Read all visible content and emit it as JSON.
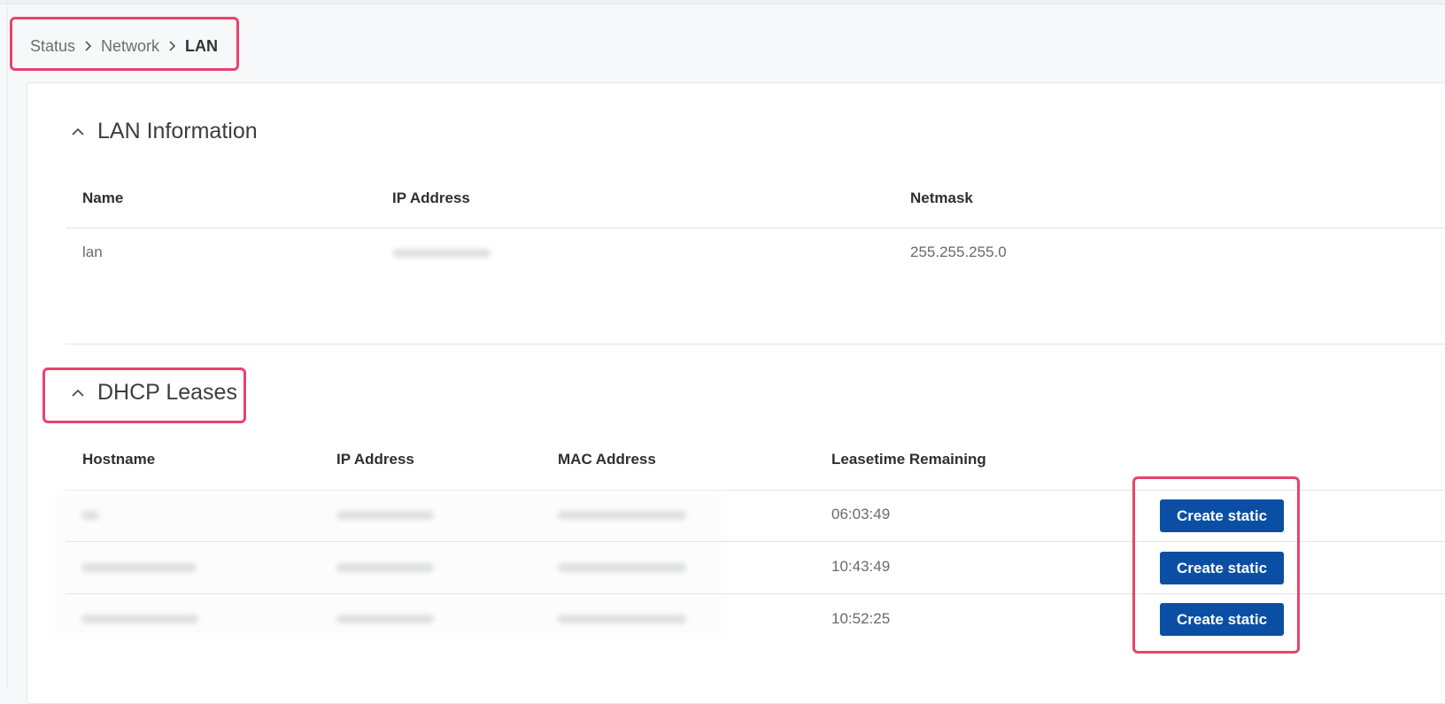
{
  "breadcrumb": {
    "items": [
      "Status",
      "Network",
      "LAN"
    ]
  },
  "lan_info": {
    "title": "LAN Information",
    "headers": [
      "Name",
      "IP Address",
      "Netmask"
    ],
    "row": {
      "name": "lan",
      "netmask": "255.255.255.0"
    }
  },
  "dhcp": {
    "title": "DHCP Leases",
    "headers": [
      "Hostname",
      "IP Address",
      "MAC Address",
      "Leasetime Remaining"
    ],
    "rows": [
      {
        "leasetime": "06:03:49",
        "action": "Create static"
      },
      {
        "leasetime": "10:43:49",
        "action": "Create static"
      },
      {
        "leasetime": "10:52:25",
        "action": "Create static"
      }
    ]
  },
  "icons": {
    "breadcrumb_separator": "chevron-right-icon",
    "section_toggle": "chevron-up-icon"
  },
  "colors": {
    "primary_button": "#0a4fa3",
    "highlight": "#e8436e"
  }
}
